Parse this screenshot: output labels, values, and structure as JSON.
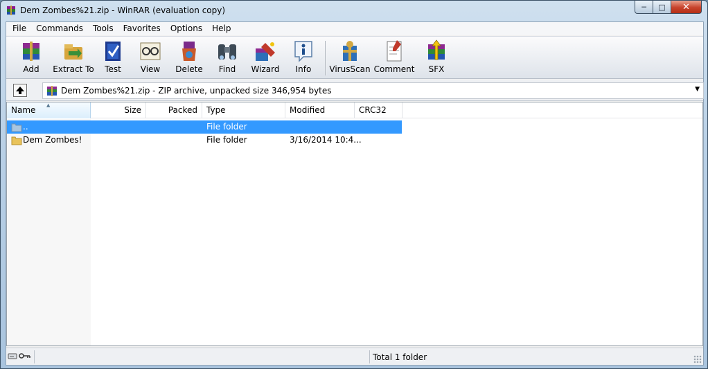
{
  "window": {
    "title": "Dem Zombes%21.zip - WinRAR (evaluation copy)"
  },
  "menu": [
    "File",
    "Commands",
    "Tools",
    "Favorites",
    "Options",
    "Help"
  ],
  "toolbar": {
    "add": "Add",
    "extract_to": "Extract To",
    "test": "Test",
    "view": "View",
    "delete": "Delete",
    "find": "Find",
    "wizard": "Wizard",
    "info": "Info",
    "virusscan": "VirusScan",
    "comment": "Comment",
    "sfx": "SFX"
  },
  "address": {
    "text": "Dem Zombes%21.zip - ZIP archive, unpacked size 346,954 bytes"
  },
  "columns": {
    "name": "Name",
    "size": "Size",
    "packed": "Packed",
    "type": "Type",
    "modified": "Modified",
    "crc": "CRC32"
  },
  "rows": [
    {
      "name": "..",
      "size": "",
      "packed": "",
      "type": "File folder",
      "modified": "",
      "crc": ""
    },
    {
      "name": "Dem Zombes!",
      "size": "",
      "packed": "",
      "type": "File folder",
      "modified": "3/16/2014 10:4...",
      "crc": ""
    }
  ],
  "status": {
    "total": "Total 1 folder"
  },
  "colors": {
    "selection": "#3399ff",
    "close_button": "#c7432c"
  },
  "icons": [
    "winrar-icon",
    "up-folder-icon",
    "folder-icon",
    "drive-icon",
    "key-icon"
  ]
}
